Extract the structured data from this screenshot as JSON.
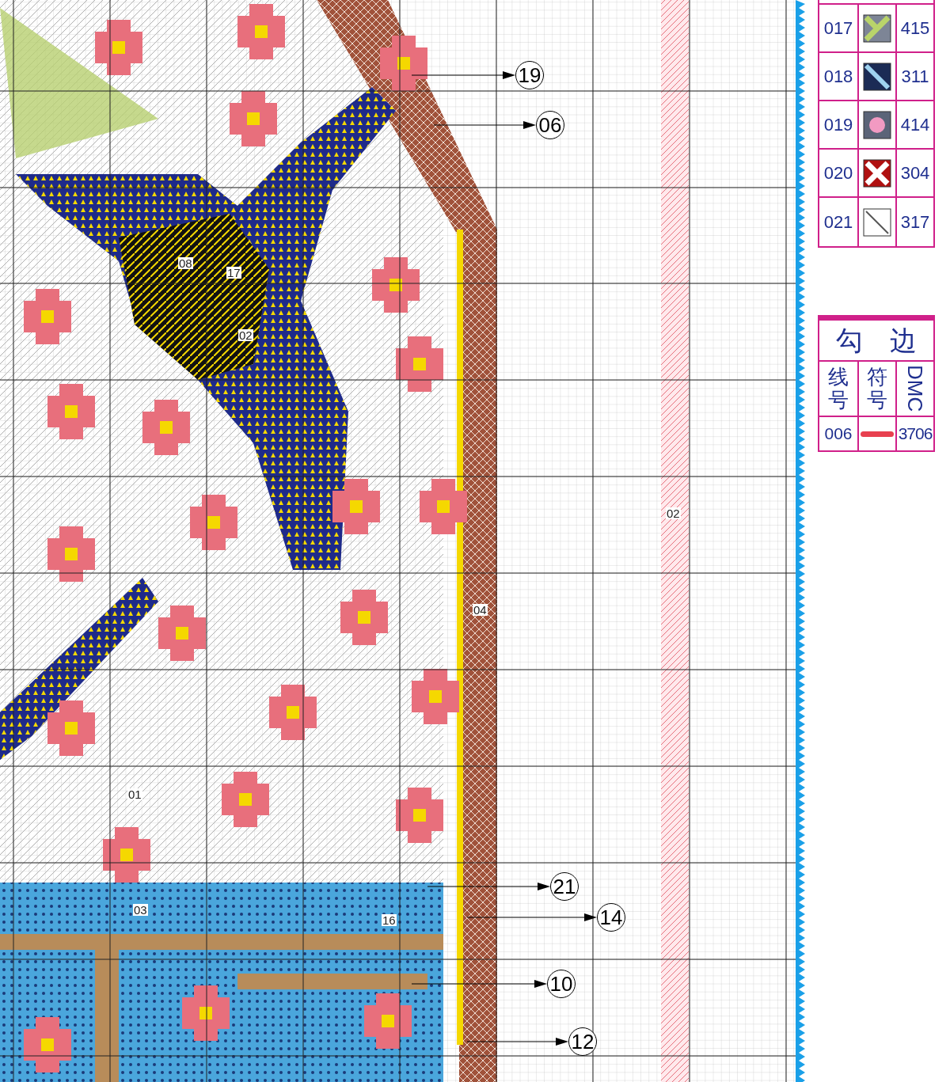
{
  "pattern": {
    "labels": [
      {
        "text": "08"
      },
      {
        "text": "17"
      },
      {
        "text": "02"
      },
      {
        "text": "01"
      },
      {
        "text": "03"
      },
      {
        "text": "16"
      },
      {
        "text": "04"
      },
      {
        "text": "02"
      }
    ],
    "callouts": [
      {
        "text": "19"
      },
      {
        "text": "06"
      },
      {
        "text": "21"
      },
      {
        "text": "14"
      },
      {
        "text": "10"
      },
      {
        "text": "12"
      }
    ]
  },
  "legend": {
    "rows": [
      {
        "thread": "017",
        "kind": "y-mark",
        "dmc": "415"
      },
      {
        "thread": "018",
        "kind": "diagonal",
        "dmc": "311"
      },
      {
        "thread": "019",
        "kind": "dot",
        "dmc": "414"
      },
      {
        "thread": "020",
        "kind": "cross",
        "dmc": "304"
      },
      {
        "thread": "021",
        "kind": "line",
        "dmc": "317"
      }
    ]
  },
  "backstitch": {
    "title": "勾　边",
    "headers": [
      "线号",
      "符号",
      "DMC"
    ],
    "rows": [
      {
        "thread": "006",
        "dmc": "3706"
      }
    ]
  }
}
